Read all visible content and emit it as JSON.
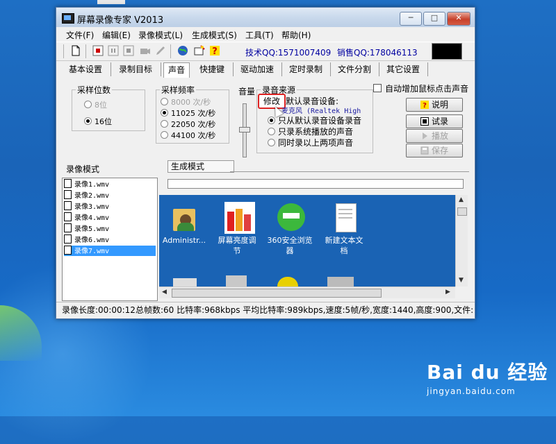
{
  "window": {
    "title": "屏幕录像专家 V2013",
    "controls": {
      "minimize": "─",
      "maximize": "□",
      "close": "✕"
    }
  },
  "menu": [
    "文件(F)",
    "编辑(E)",
    "录像模式(L)",
    "生成模式(S)",
    "工具(T)",
    "帮助(H)"
  ],
  "toolbar": {
    "icons": [
      "new-file-icon",
      "record-icon",
      "pause-icon",
      "stop-icon",
      "camera-icon",
      "pen-icon",
      "globe-icon",
      "wizard-icon",
      "help-icon"
    ],
    "tech_qq": "技术QQ:1571007409",
    "sales_qq": "销售QQ:178046113"
  },
  "tabs": [
    "基本设置",
    "录制目标",
    "声音",
    "快捷键",
    "驱动加速",
    "定时录制",
    "文件分割",
    "其它设置"
  ],
  "active_tab": "声音",
  "sample_bits": {
    "label": "采样位数",
    "options": [
      {
        "label": "8位",
        "selected": false,
        "disabled": true
      },
      {
        "label": "16位",
        "selected": true,
        "disabled": false
      }
    ]
  },
  "sample_rate": {
    "label": "采样频率",
    "options": [
      {
        "label": "8000 次/秒",
        "selected": false,
        "disabled": true
      },
      {
        "label": "11025 次/秒",
        "selected": true,
        "disabled": false
      },
      {
        "label": "22050 次/秒",
        "selected": false,
        "disabled": false
      },
      {
        "label": "44100 次/秒",
        "selected": false,
        "disabled": false
      }
    ]
  },
  "volume": {
    "label": "音量"
  },
  "audio_source": {
    "label": "录音来源",
    "modify_button": "修改",
    "default_device_label": "默认录音设备:",
    "device_name": "麦克风 (Realtek High",
    "options": [
      {
        "label": "只从默认录音设备录音",
        "selected": true
      },
      {
        "label": "只录系统播放的声音",
        "selected": false
      },
      {
        "label": "同时录以上两项声音",
        "selected": false
      }
    ]
  },
  "click_sound_checkbox": {
    "label": "自动增加鼠标点击声音",
    "checked": false
  },
  "side_buttons": {
    "help": "说明",
    "test_record": "试录",
    "play": "播放",
    "save": "保存"
  },
  "record_mode_label": "录像模式",
  "generate_mode_label": "生成模式",
  "files": [
    "录像1.wmv",
    "录像2.wmv",
    "录像3.wmv",
    "录像4.wmv",
    "录像5.wmv",
    "录像6.wmv",
    "录像7.wmv"
  ],
  "selected_file": "录像7.wmv",
  "preview_icons": [
    {
      "label1": "Administr...",
      "label2": "",
      "icon": "user-folder-icon"
    },
    {
      "label1": "屏幕亮度调",
      "label2": "节",
      "icon": "brightness-app-icon"
    },
    {
      "label1": "360安全浏览",
      "label2": "器",
      "icon": "browser-360-icon"
    },
    {
      "label1": "新建文本文",
      "label2": "档",
      "icon": "text-document-icon"
    }
  ],
  "status": "录像长度:00:00:12总帧数:60 比特率:968kbps 平均比特率:989kbps,速度:5帧/秒,宽度:1440,高度:900,文件:",
  "watermark": {
    "logo": "Bai du 经验",
    "url": "jingyan.baidu.com"
  },
  "colors": {
    "desktop": "#1a64b8",
    "selection": "#3399ff",
    "highlight_border": "#dd2222",
    "qq_text": "#0000a0"
  }
}
